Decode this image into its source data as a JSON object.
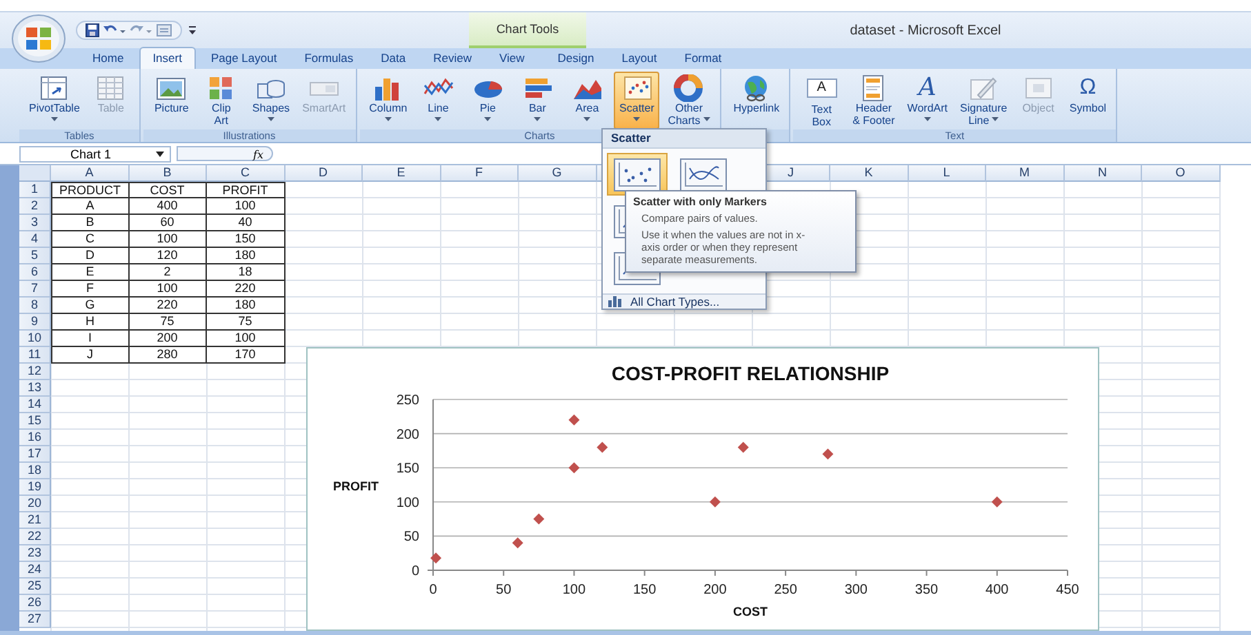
{
  "window": {
    "title": "dataset - Microsoft Excel",
    "context_tab_group": "Chart Tools"
  },
  "tabs": [
    {
      "label": "Home",
      "selected": false
    },
    {
      "label": "Insert",
      "selected": true
    },
    {
      "label": "Page Layout",
      "selected": false
    },
    {
      "label": "Formulas",
      "selected": false
    },
    {
      "label": "Data",
      "selected": false
    },
    {
      "label": "Review",
      "selected": false
    },
    {
      "label": "View",
      "selected": false
    },
    {
      "label": "Design",
      "selected": false
    },
    {
      "label": "Layout",
      "selected": false
    },
    {
      "label": "Format",
      "selected": false
    }
  ],
  "ribbon": {
    "groups": [
      {
        "label": "Tables",
        "buttons": [
          {
            "lines": [
              "PivotTable"
            ],
            "dropdown": true,
            "disabled": false,
            "selected": false
          },
          {
            "lines": [
              "Table"
            ],
            "dropdown": false,
            "disabled": true,
            "selected": false
          }
        ]
      },
      {
        "label": "Illustrations",
        "buttons": [
          {
            "lines": [
              "Picture"
            ],
            "dropdown": false,
            "disabled": false,
            "selected": false
          },
          {
            "lines": [
              "Clip",
              "Art"
            ],
            "dropdown": false,
            "disabled": false,
            "selected": false
          },
          {
            "lines": [
              "Shapes"
            ],
            "dropdown": true,
            "disabled": false,
            "selected": false
          },
          {
            "lines": [
              "SmartArt"
            ],
            "dropdown": false,
            "disabled": true,
            "selected": false
          }
        ]
      },
      {
        "label": "Charts",
        "buttons": [
          {
            "lines": [
              "Column"
            ],
            "dropdown": true,
            "disabled": false,
            "selected": false
          },
          {
            "lines": [
              "Line"
            ],
            "dropdown": true,
            "disabled": false,
            "selected": false
          },
          {
            "lines": [
              "Pie"
            ],
            "dropdown": true,
            "disabled": false,
            "selected": false
          },
          {
            "lines": [
              "Bar"
            ],
            "dropdown": true,
            "disabled": false,
            "selected": false
          },
          {
            "lines": [
              "Area"
            ],
            "dropdown": true,
            "disabled": false,
            "selected": false
          },
          {
            "lines": [
              "Scatter"
            ],
            "dropdown": true,
            "disabled": false,
            "selected": true
          },
          {
            "lines": [
              "Other",
              "Charts"
            ],
            "dropdown": true,
            "disabled": false,
            "selected": false
          }
        ]
      },
      {
        "buttons": [
          {
            "lines": [
              "Hyperlink"
            ],
            "dropdown": false,
            "disabled": false,
            "selected": false
          }
        ]
      },
      {
        "label": "Text",
        "buttons": [
          {
            "lines": [
              "Text",
              "Box"
            ],
            "glyph": "A",
            "dropdown": false,
            "disabled": false,
            "selected": false
          },
          {
            "lines": [
              "Header",
              "& Footer"
            ],
            "dropdown": false,
            "disabled": false,
            "selected": false
          },
          {
            "lines": [
              "WordArt"
            ],
            "glyph": "A",
            "dropdown": true,
            "disabled": false,
            "selected": false
          },
          {
            "lines": [
              "Signature",
              "Line"
            ],
            "dropdown": true,
            "disabled": false,
            "selected": false
          },
          {
            "lines": [
              "Object"
            ],
            "dropdown": false,
            "disabled": true,
            "selected": false
          },
          {
            "lines": [
              "Symbol"
            ],
            "glyph": "Ω",
            "dropdown": false,
            "disabled": false,
            "selected": false
          }
        ]
      }
    ]
  },
  "formula_bar": {
    "name_box": "Chart 1",
    "function_button": "fx"
  },
  "sheet": {
    "columns_left": [
      "A",
      "B",
      "C",
      "D",
      "E",
      "F",
      "G"
    ],
    "columns_right": [
      "J",
      "K",
      "L",
      "M",
      "N",
      "O"
    ],
    "row_numbers": [
      "1",
      "2",
      "3",
      "4",
      "5",
      "6",
      "7",
      "8",
      "9",
      "10",
      "11",
      "12",
      "13",
      "14",
      "15",
      "16",
      "17",
      "18",
      "19",
      "20",
      "21",
      "22",
      "23",
      "24",
      "25",
      "26",
      "27"
    ],
    "rows": [
      [
        "PRODUCT",
        "COST",
        "PROFIT"
      ],
      [
        "A",
        "400",
        "100"
      ],
      [
        "B",
        "60",
        "40"
      ],
      [
        "C",
        "100",
        "150"
      ],
      [
        "D",
        "120",
        "180"
      ],
      [
        "E",
        "2",
        "18"
      ],
      [
        "F",
        "100",
        "220"
      ],
      [
        "G",
        "220",
        "180"
      ],
      [
        "H",
        "75",
        "75"
      ],
      [
        "I",
        "200",
        "100"
      ],
      [
        "J",
        "280",
        "170"
      ]
    ]
  },
  "chart": {
    "chart_data": {
      "type": "scatter",
      "title": "COST-PROFIT RELATIONSHIP",
      "xlabel": "COST",
      "ylabel": "PROFIT",
      "x": [
        400,
        60,
        100,
        120,
        2,
        100,
        220,
        75,
        200,
        280
      ],
      "series": [
        {
          "color": "#c0504d",
          "values": [
            100,
            40,
            150,
            180,
            18,
            220,
            180,
            75,
            100,
            170
          ]
        }
      ],
      "grid": true,
      "xlim": [
        0,
        450
      ],
      "ylim": [
        0,
        250
      ],
      "xticks": [
        0,
        50,
        100,
        150,
        200,
        250,
        300,
        350,
        400,
        450
      ],
      "yticks": [
        0,
        50,
        100,
        150,
        200,
        250
      ]
    }
  },
  "scatter_menu": {
    "title": "Scatter",
    "option_rows": [
      [
        {
          "selected": true
        },
        {
          "selected": false
        }
      ],
      [
        {
          "selected": false
        }
      ],
      [
        {
          "selected": false
        }
      ]
    ],
    "footer": "All Chart Types..."
  },
  "tooltip": {
    "title": "Scatter with only Markers",
    "lines": [
      "Compare pairs of values.",
      "Use it when the values are not in x-axis order or when they represent separate measurements."
    ]
  }
}
